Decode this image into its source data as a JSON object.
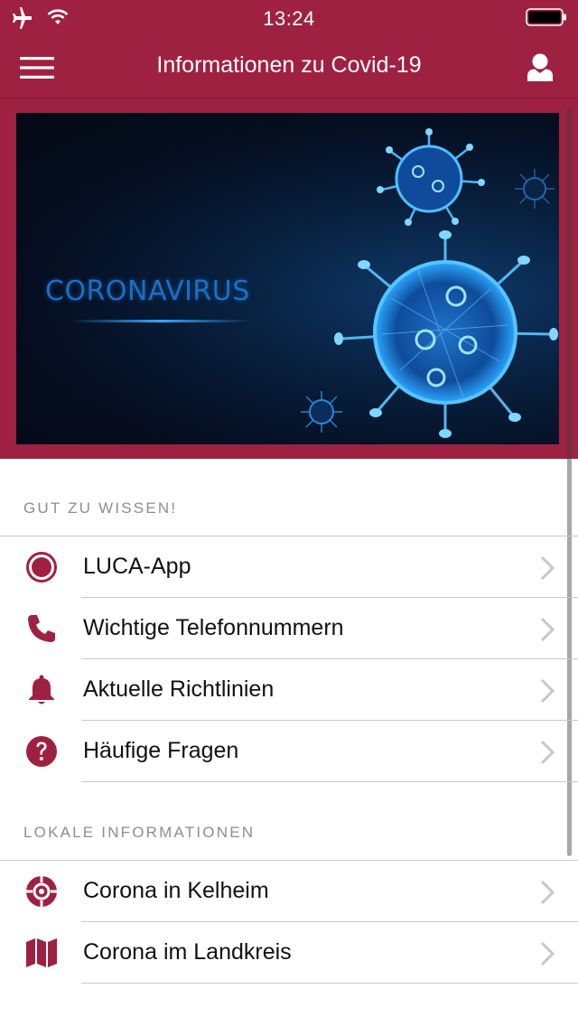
{
  "status": {
    "time": "13:24"
  },
  "navbar": {
    "title": "Informationen zu Covid-19"
  },
  "hero": {
    "text": "CORONAVIRUS"
  },
  "sections": [
    {
      "header": "GUT ZU WISSEN!",
      "items": [
        {
          "label": "LUCA-App",
          "icon": "record-circle-icon"
        },
        {
          "label": "Wichtige Telefonnummern",
          "icon": "phone-icon"
        },
        {
          "label": "Aktuelle Richtlinien",
          "icon": "bell-icon"
        },
        {
          "label": "Häufige Fragen",
          "icon": "question-circle-icon"
        }
      ]
    },
    {
      "header": "LOKALE INFORMATIONEN",
      "items": [
        {
          "label": "Corona in Kelheim",
          "icon": "location-target-icon"
        },
        {
          "label": "Corona im Landkreis",
          "icon": "map-icon"
        }
      ]
    }
  ],
  "colors": {
    "brand": "#9f2142",
    "icon": "#9f2142",
    "text": "#111111",
    "section_header": "#8e8e8e"
  }
}
